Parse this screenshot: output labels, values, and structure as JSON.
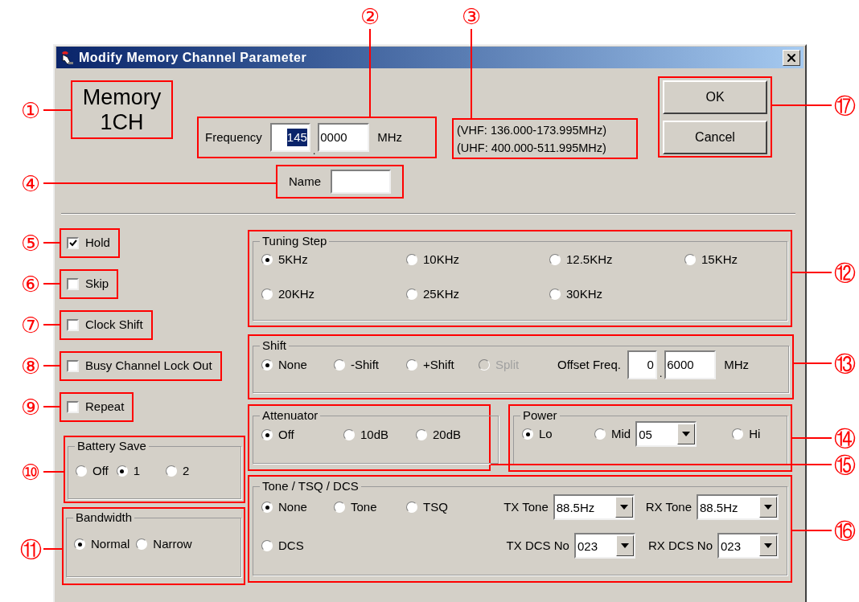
{
  "window": {
    "title": "Modify Memory Channel Parameter"
  },
  "memory": {
    "line_1": "Memory",
    "line_2": "1CH"
  },
  "frequency": {
    "label": "Frequency",
    "mhz_value": "145",
    "selected": true,
    "separator": ".",
    "khz_value": "0000",
    "unit": "MHz"
  },
  "range": [
    "(VHF: 136.000-173.995MHz)",
    "(UHF: 400.000-511.995MHz)"
  ],
  "name": {
    "label": "Name"
  },
  "buttons": [
    "OK",
    "Cancel"
  ],
  "checkboxes": [
    {
      "label": "Hold",
      "checked": true
    },
    {
      "label": "Skip",
      "checked": false
    },
    {
      "label": "Clock Shift",
      "checked": false
    },
    {
      "label": "Busy Channel Lock Out",
      "checked": false
    },
    {
      "label": "Repeat",
      "checked": false
    }
  ],
  "battery_save": {
    "title": "Battery Save",
    "options": [
      {
        "label": "Off",
        "selected": false
      },
      {
        "label": "1",
        "selected": true
      },
      {
        "label": "2",
        "selected": false
      }
    ]
  },
  "bandwidth": {
    "title": "Bandwidth",
    "options": [
      {
        "label": "Normal",
        "selected": true
      },
      {
        "label": "Narrow",
        "selected": false
      }
    ]
  },
  "tuning_step": {
    "title": "Tuning Step",
    "options": [
      {
        "label": "5KHz",
        "selected": true
      },
      {
        "label": "10KHz",
        "selected": false
      },
      {
        "label": "12.5KHz",
        "selected": false
      },
      {
        "label": "15KHz",
        "selected": false
      },
      {
        "label": "20KHz",
        "selected": false
      },
      {
        "label": "25KHz",
        "selected": false
      },
      {
        "label": "30KHz",
        "selected": false
      }
    ]
  },
  "shift": {
    "title": "Shift",
    "options": [
      {
        "label": "None",
        "selected": true,
        "disabled": false
      },
      {
        "label": "-Shift",
        "selected": false,
        "disabled": false
      },
      {
        "label": "+Shift",
        "selected": false,
        "disabled": false
      },
      {
        "label": "Split",
        "selected": false,
        "disabled": true
      }
    ],
    "offset": {
      "label": "Offset Freq.",
      "value_1": "0",
      "separator": ".",
      "value_2": "6000",
      "unit": "MHz"
    }
  },
  "attenuator": {
    "title": "Attenuator",
    "options": [
      {
        "label": "Off",
        "selected": true
      },
      {
        "label": "10dB",
        "selected": false
      },
      {
        "label": "20dB",
        "selected": false
      }
    ]
  },
  "power": {
    "title": "Power",
    "options": [
      {
        "label": "Lo",
        "selected": true
      },
      {
        "label": "Mid",
        "selected": false
      },
      {
        "label": "Hi",
        "selected": false
      }
    ],
    "mid_value": "05"
  },
  "tone": {
    "title": "Tone / TSQ / DCS",
    "options": [
      {
        "label": "None",
        "selected": true
      },
      {
        "label": "Tone",
        "selected": false
      },
      {
        "label": "TSQ",
        "selected": false
      },
      {
        "label": "DCS",
        "selected": false
      }
    ],
    "tx_tone": {
      "label": "TX Tone",
      "value": "88.5Hz"
    },
    "rx_tone": {
      "label": "RX Tone",
      "value": "88.5Hz"
    },
    "tx_dcs": {
      "label": "TX DCS No",
      "value": "023"
    },
    "rx_dcs": {
      "label": "RX DCS No",
      "value": "023"
    }
  },
  "callouts": [
    "②",
    "③",
    "①",
    "④",
    "⑤",
    "⑥",
    "⑦",
    "⑧",
    "⑨",
    "⑩",
    "⑪",
    "⑰",
    "⑫",
    "⑬",
    "⑭",
    "⑮",
    "⑯"
  ]
}
